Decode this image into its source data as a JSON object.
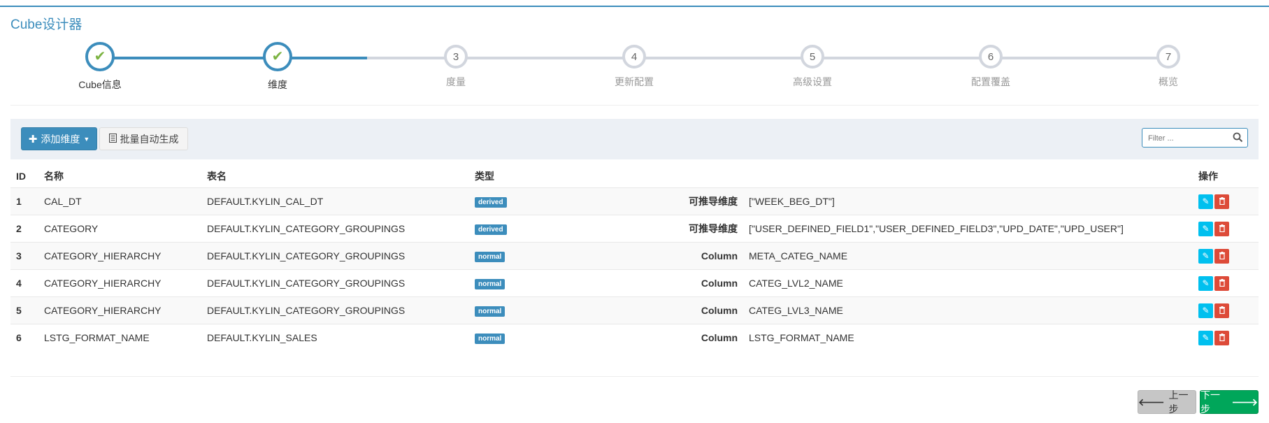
{
  "app": {
    "title": "Cube设计器"
  },
  "colors": {
    "primary": "#3c8dbc",
    "success": "#00a65a",
    "danger": "#dd4b39",
    "info": "#00c0ef",
    "check": "#7cb342"
  },
  "steps": [
    {
      "label": "Cube信息",
      "number": "1",
      "state": "done"
    },
    {
      "label": "维度",
      "number": "2",
      "state": "done"
    },
    {
      "label": "度量",
      "number": "3",
      "state": "pending"
    },
    {
      "label": "更新配置",
      "number": "4",
      "state": "pending"
    },
    {
      "label": "高级设置",
      "number": "5",
      "state": "pending"
    },
    {
      "label": "配置覆盖",
      "number": "6",
      "state": "pending"
    },
    {
      "label": "概览",
      "number": "7",
      "state": "pending"
    }
  ],
  "toolbar": {
    "add_label": "添加维度",
    "add_icon": "plus-icon",
    "batch_label": "批量自动生成",
    "batch_icon": "list-alt-icon",
    "filter_placeholder": "Filter ..."
  },
  "table": {
    "headers": {
      "id": "ID",
      "name": "名称",
      "table": "表名",
      "type": "类型",
      "ops": "操作"
    },
    "rows": [
      {
        "id": "1",
        "name": "CAL_DT",
        "table": "DEFAULT.KYLIN_CAL_DT",
        "type": "derived",
        "col_type": "可推导维度",
        "cols": "[\"WEEK_BEG_DT\"]"
      },
      {
        "id": "2",
        "name": "CATEGORY",
        "table": "DEFAULT.KYLIN_CATEGORY_GROUPINGS",
        "type": "derived",
        "col_type": "可推导维度",
        "cols": "[\"USER_DEFINED_FIELD1\",\"USER_DEFINED_FIELD3\",\"UPD_DATE\",\"UPD_USER\"]"
      },
      {
        "id": "3",
        "name": "CATEGORY_HIERARCHY",
        "table": "DEFAULT.KYLIN_CATEGORY_GROUPINGS",
        "type": "normal",
        "col_type": "Column",
        "cols": "META_CATEG_NAME"
      },
      {
        "id": "4",
        "name": "CATEGORY_HIERARCHY",
        "table": "DEFAULT.KYLIN_CATEGORY_GROUPINGS",
        "type": "normal",
        "col_type": "Column",
        "cols": "CATEG_LVL2_NAME"
      },
      {
        "id": "5",
        "name": "CATEGORY_HIERARCHY",
        "table": "DEFAULT.KYLIN_CATEGORY_GROUPINGS",
        "type": "normal",
        "col_type": "Column",
        "cols": "CATEG_LVL3_NAME"
      },
      {
        "id": "6",
        "name": "LSTG_FORMAT_NAME",
        "table": "DEFAULT.KYLIN_SALES",
        "type": "normal",
        "col_type": "Column",
        "cols": "LSTG_FORMAT_NAME"
      }
    ]
  },
  "footer": {
    "prev_label": "上一步",
    "next_label": "下一步"
  }
}
